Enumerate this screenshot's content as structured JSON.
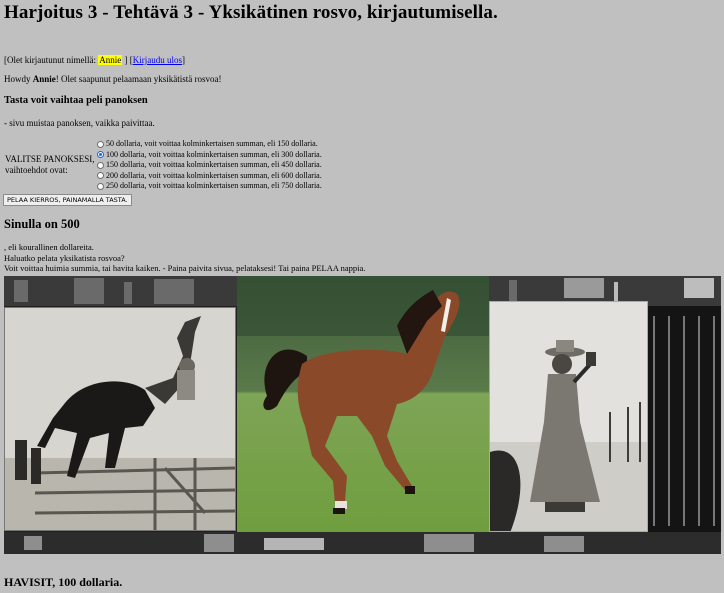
{
  "page": {
    "title": "Harjoitus 3 - Tehtävä 3 - Yksikätinen rosvo, kirjautumisella."
  },
  "login": {
    "prefix": "[Olet kirjautunut nimellä: ",
    "username": "Annie",
    "suffix": " ] [",
    "logout_label": "Kirjaudu ulos",
    "close": "]"
  },
  "greeting": {
    "prefix": "Howdy ",
    "name": "Annie",
    "suffix": "! Olet saapunut pelaamaan yksikätistä rosvoa!"
  },
  "stake_section": {
    "heading": "Tasta voit vaihtaa peli panoksen",
    "note": "- sivu muistaa panoksen, vaikka paivittaa.",
    "label_line1": "VALITSE PANOKSESI,",
    "label_line2": "vaihtoehdot ovat:",
    "options": [
      {
        "label": "50 dollaria, voit voittaa kolminkertaisen summan, eli 150 dollaria.",
        "checked": false
      },
      {
        "label": "100 dollaria, voit voittaa kolminkertaisen summan, eli 300 dollaria.",
        "checked": true
      },
      {
        "label": "150 dollaria, voit voittaa kolminkertaisen summan, eli 450 dollaria.",
        "checked": false
      },
      {
        "label": "200 dollaria, voit voittaa kolminkertaisen summan, eli 600 dollaria.",
        "checked": false
      },
      {
        "label": "250 dollaria, voit voittaa kolminkertaisen summan, eli 750 dollaria.",
        "checked": false
      }
    ],
    "play_button_label": "PELAA KIERROS, PAINAMALLA TASTA."
  },
  "balance": {
    "heading": "Sinulla on 500",
    "line1": ", eli kourallinen dollareita.",
    "line2": "Haluatko pelata yksikatista rosvoa?",
    "line3": "Voit voittaa huimia summia, tai havita kaiken. - Paina paivita sivua, pelataksesi! Tai paina PELAA nappia."
  },
  "slot_images": {
    "left": "rodeo-rider-photo",
    "middle": "galloping-horse-photo",
    "right": "cowgirl-with-rifle-photo"
  },
  "result": {
    "text": "HAVISIT, 100 dollaria."
  },
  "colors": {
    "page_background": "#c0c0c0",
    "name_highlight": "#ffff00",
    "link": "#0000ee"
  }
}
